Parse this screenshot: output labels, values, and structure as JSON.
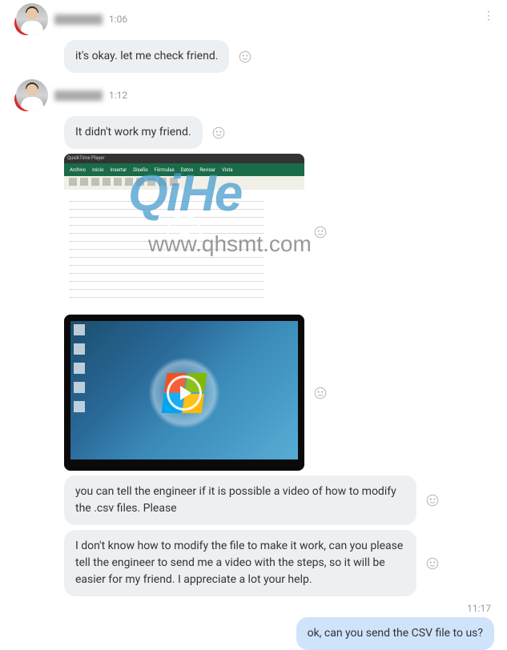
{
  "menu": {
    "aria": "More options"
  },
  "watermark": {
    "brand": "QiHe",
    "url": "www.qhsmt.com"
  },
  "messages": [
    {
      "id": "m1",
      "side": "received",
      "timestamp": "1:06",
      "text": "it's okay.  let me check friend."
    },
    {
      "id": "m2",
      "side": "received",
      "timestamp": "1:12",
      "text": "It didn't work my friend."
    },
    {
      "id": "m3",
      "side": "received",
      "type": "video",
      "thumb": "excel-quicktime"
    },
    {
      "id": "m4",
      "side": "received",
      "type": "video",
      "thumb": "windows7-desktop"
    },
    {
      "id": "m5",
      "side": "received",
      "text": "you can tell the engineer if it is possible a video of how to modify the .csv files. Please"
    },
    {
      "id": "m6",
      "side": "received",
      "text": "I don't know how to modify the file to make it work, can you please tell the engineer to send me a video with the steps, so it will be easier for my friend. I appreciate a lot your help."
    }
  ],
  "sent_block": {
    "timestamp": "11:17",
    "text": "ok, can you send the CSV file to us?"
  },
  "react_aria": "Add reaction"
}
